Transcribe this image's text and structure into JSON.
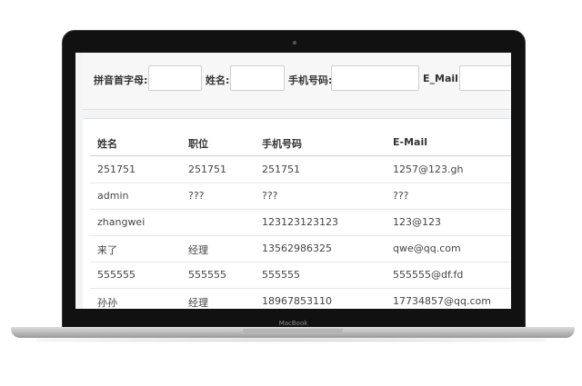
{
  "device": {
    "brand": "MacBook"
  },
  "filters": [
    {
      "label": "拼音首字母:"
    },
    {
      "label": "姓名:"
    },
    {
      "label": "手机号码:"
    },
    {
      "label": "E_Mail:"
    }
  ],
  "table": {
    "headers": [
      "姓名",
      "职位",
      "手机号码",
      "E-Mail"
    ],
    "rows": [
      [
        "251751",
        "251751",
        "251751",
        "1257@123.gh"
      ],
      [
        "admin",
        "???",
        "???",
        "???"
      ],
      [
        "zhangwei",
        "",
        "123123123123",
        "123@123"
      ],
      [
        "来了",
        "经理",
        "13562986325",
        "qwe@qq.com"
      ],
      [
        "555555",
        "555555",
        "555555",
        "555555@df.fd"
      ],
      [
        "孙孙",
        "经理",
        "18967853110",
        "17734857@qq.com"
      ]
    ]
  }
}
